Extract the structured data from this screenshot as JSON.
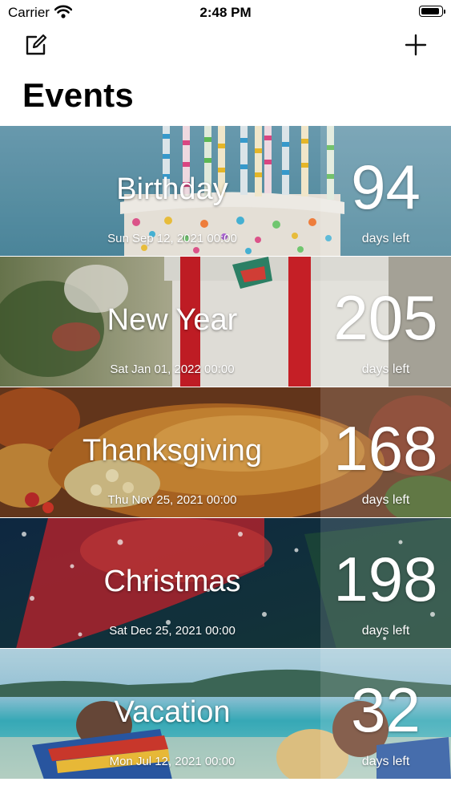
{
  "status_bar": {
    "carrier": "Carrier",
    "time": "2:48 PM",
    "battery_level": 0.95
  },
  "navigation": {
    "title": "Events",
    "left_icon": "compose-icon",
    "right_icon": "plus-icon"
  },
  "events": [
    {
      "name": "Birthday",
      "date": "Sun Sep 12, 2021 00:00",
      "days": "94",
      "days_label": "days left"
    },
    {
      "name": "New Year",
      "date": "Sat Jan 01, 2022 00:00",
      "days": "205",
      "days_label": "days left"
    },
    {
      "name": "Thanksgiving",
      "date": "Thu Nov 25, 2021 00:00",
      "days": "168",
      "days_label": "days left"
    },
    {
      "name": "Christmas",
      "date": "Sat Dec 25, 2021 00:00",
      "days": "198",
      "days_label": "days left"
    },
    {
      "name": "Vacation",
      "date": "Mon Jul 12, 2021 00:00",
      "days": "32",
      "days_label": "days left"
    }
  ]
}
